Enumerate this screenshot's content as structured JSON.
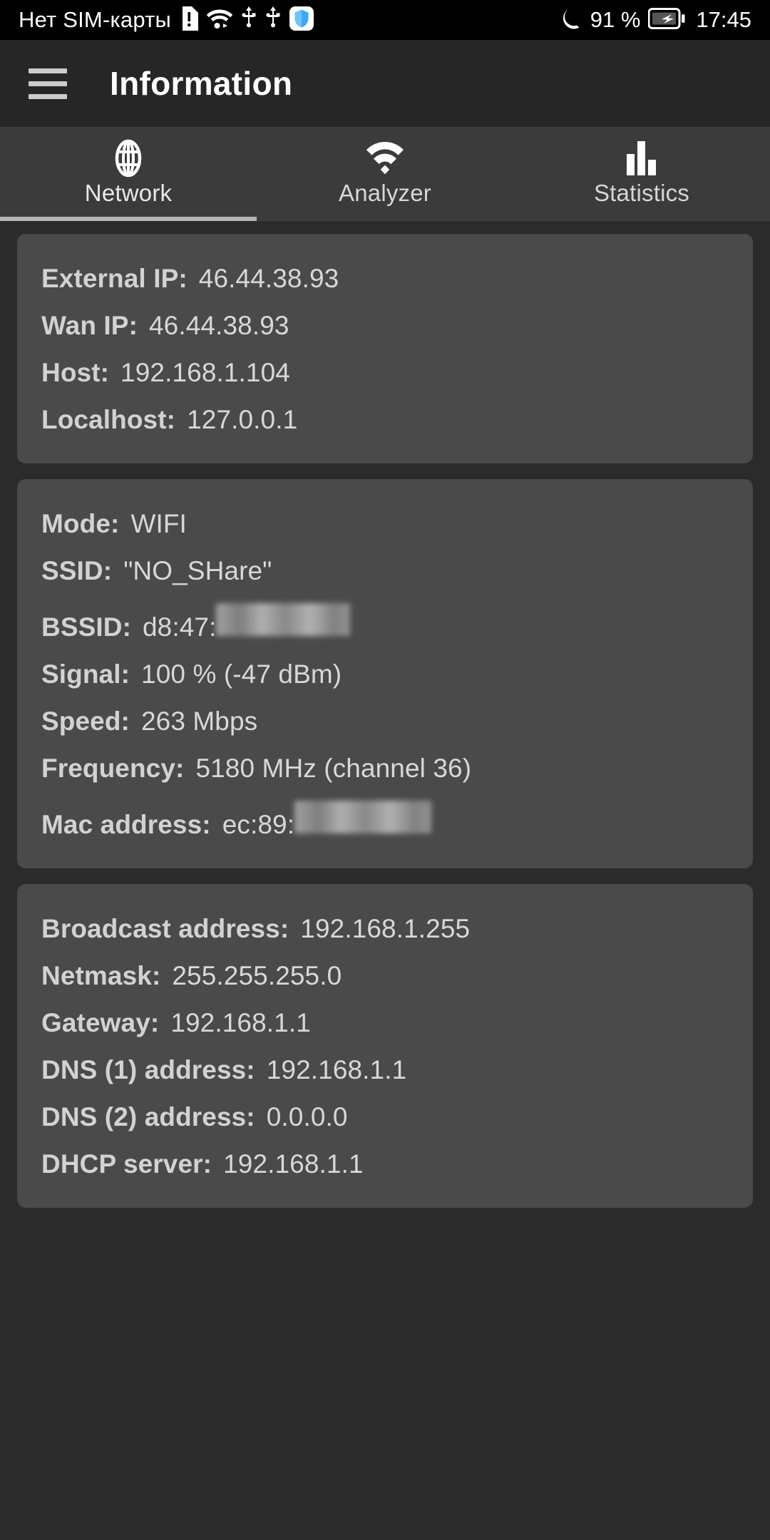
{
  "status_bar": {
    "carrier": "Нет SIM-карты",
    "battery_percent": "91 %",
    "clock": "17:45",
    "icons": [
      "sim-alert-icon",
      "wifi-icon",
      "usb-icon",
      "usb-icon",
      "shield-icon",
      "moon-icon",
      "battery-charging-icon"
    ],
    "shield_color": "#2196f3"
  },
  "app_bar": {
    "menu_icon": "hamburger-icon",
    "title": "Information"
  },
  "tabs": [
    {
      "label": "Network",
      "icon": "globe-icon",
      "active": true
    },
    {
      "label": "Analyzer",
      "icon": "wifi-icon",
      "active": false
    },
    {
      "label": "Statistics",
      "icon": "bar-chart-icon",
      "active": false
    }
  ],
  "cards": [
    {
      "rows": [
        {
          "label": "External IP:",
          "value": "46.44.38.93"
        },
        {
          "label": "Wan IP:",
          "value": "46.44.38.93"
        },
        {
          "label": "Host:",
          "value": "192.168.1.104"
        },
        {
          "label": "Localhost:",
          "value": "127.0.0.1"
        }
      ]
    },
    {
      "rows": [
        {
          "label": "Mode:",
          "value": "WIFI"
        },
        {
          "label": "SSID:",
          "value": "\"NO_SHare\""
        },
        {
          "label": "BSSID:",
          "value": "d8:47:",
          "redacted": true
        },
        {
          "label": "Signal:",
          "value": "100 % (-47 dBm)"
        },
        {
          "label": "Speed:",
          "value": "263 Mbps"
        },
        {
          "label": "Frequency:",
          "value": "5180 MHz (channel 36)"
        },
        {
          "label": "Mac address:",
          "value": "ec:89:",
          "redacted": true
        }
      ]
    },
    {
      "rows": [
        {
          "label": "Broadcast address:",
          "value": "192.168.1.255"
        },
        {
          "label": "Netmask:",
          "value": "255.255.255.0"
        },
        {
          "label": "Gateway:",
          "value": "192.168.1.1"
        },
        {
          "label": "DNS (1) address:",
          "value": "192.168.1.1"
        },
        {
          "label": "DNS (2) address:",
          "value": "0.0.0.0"
        },
        {
          "label": "DHCP server:",
          "value": "192.168.1.1"
        }
      ]
    }
  ]
}
